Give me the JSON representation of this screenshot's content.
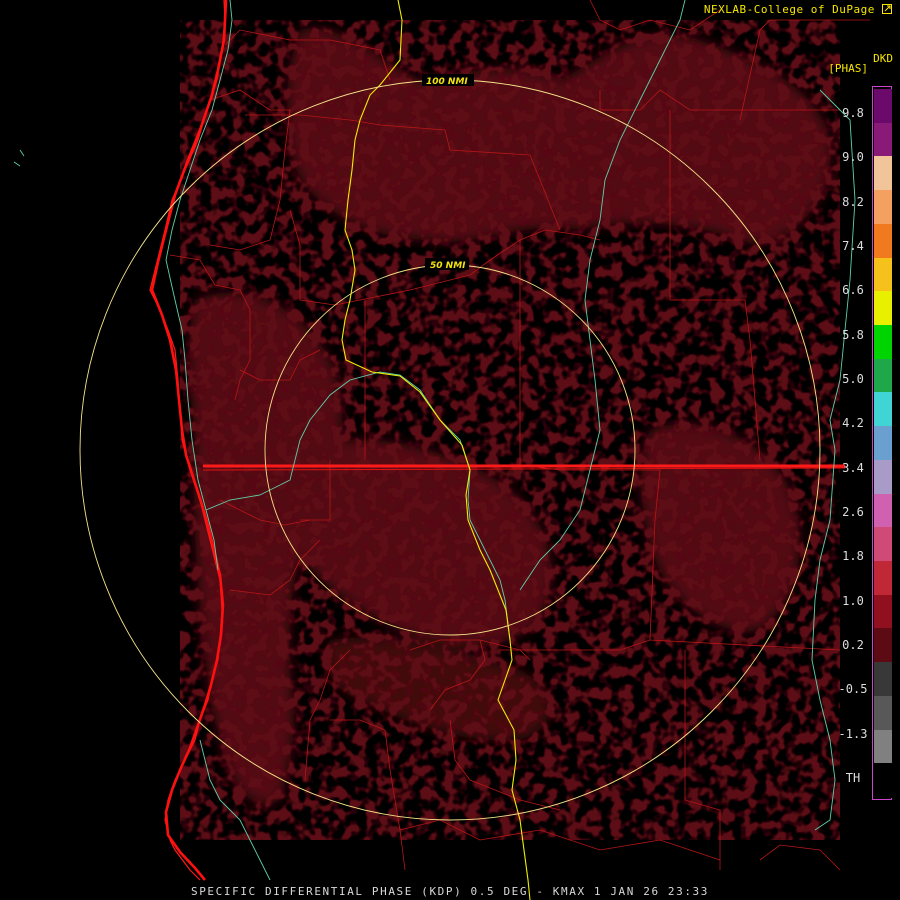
{
  "credit": "NEXLAB-College of DuPage",
  "credit_icon": "external-link-icon",
  "legend": {
    "product": "DKD",
    "units": "[PHAS]",
    "ticks": [
      "9.8",
      "9.0",
      "8.2",
      "7.4",
      "6.6",
      "5.8",
      "5.0",
      "4.2",
      "3.4",
      "2.6",
      "1.8",
      "1.0",
      "0.2",
      "-0.5",
      "-1.3",
      "TH"
    ],
    "colors": [
      "#6b0a6b",
      "#8a1a78",
      "#f2c49a",
      "#f4a060",
      "#f27a1e",
      "#f4c21a",
      "#e8f000",
      "#00d400",
      "#1fa84a",
      "#40d4d4",
      "#6aa0d0",
      "#a89bc8",
      "#d060b0",
      "#d04a78",
      "#c02838",
      "#901020",
      "#5c0a14",
      "#383838",
      "#585858",
      "#808080",
      "#000000"
    ]
  },
  "range_rings": [
    "50 NMI",
    "100 NMI"
  ],
  "footer": "SPECIFIC DIFFERENTIAL PHASE (KDP) 0.5 DEG - KMAX 1 JAN 26 23:33",
  "colors": {
    "echo": "#5c0a14",
    "echo_dark": "#3a050c",
    "county_lines": "#c01818",
    "state_lines": "#ff1a1a",
    "highways": "#eeee00",
    "rivers": "#5fd0a8",
    "rings": "#f4e48a",
    "text": "#f7e600"
  }
}
